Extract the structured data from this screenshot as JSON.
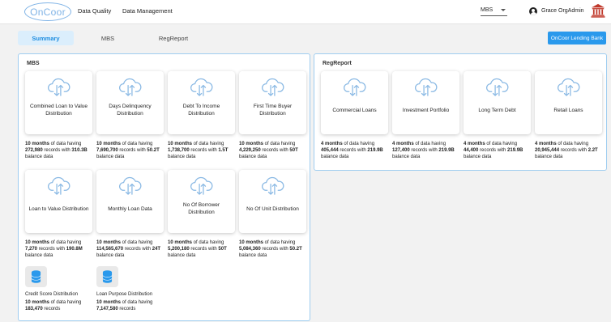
{
  "header": {
    "logo": "OnCoor",
    "nav": [
      "Data Quality",
      "Data Management"
    ],
    "select": "MBS",
    "user": "Grace OrgAdmin"
  },
  "tabs": [
    "Summary",
    "MBS",
    "RegReport"
  ],
  "bank_button": "OnCoor Lending Bank",
  "colors": {
    "accent": "#2a99ec",
    "tab_active_bg": "#dbeefc",
    "panel_border": "#9fcdf0",
    "icon": "#8ab9e4",
    "bank_icon": "#c0392b"
  },
  "mbs": {
    "title": "MBS",
    "tiles": [
      {
        "label": "Combined Loan to Value Distribution",
        "months": "10 months",
        "d1": " of data having ",
        "records": "272,980",
        "d2": " records with ",
        "balance": "310.3B",
        "d3": " balance data"
      },
      {
        "label": "Days Delinquency Distribution",
        "months": "10 months",
        "d1": " of data having ",
        "records": "7,690,700",
        "d2": " records with ",
        "balance": "50.2T",
        "d3": " balance data"
      },
      {
        "label": "Debt To Income Distribution",
        "months": "10 months",
        "d1": " of data having ",
        "records": "1,738,700",
        "d2": " records with ",
        "balance": "1.5T",
        "d3": " balance data"
      },
      {
        "label": "First Time Buyer Distribution",
        "months": "10 months",
        "d1": " of data having ",
        "records": "4,229,250",
        "d2": " records with ",
        "balance": "50T",
        "d3": " balance data"
      },
      {
        "label": "Loan to Value Distribution",
        "months": "10 months",
        "d1": " of data having ",
        "records": "7,270",
        "d2": " records with ",
        "balance": "190.8M",
        "d3": " balance data"
      },
      {
        "label": "Monthly Loan Data",
        "months": "10 months",
        "d1": " of data having ",
        "records": "114,565,670",
        "d2": " records with ",
        "balance": "24T",
        "d3": " balance data"
      },
      {
        "label": "No Of Borrower Distribution",
        "months": "10 months",
        "d1": " of data having ",
        "records": "5,200,180",
        "d2": " records with ",
        "balance": "50T",
        "d3": " balance data"
      },
      {
        "label": "No Of Unit Distribution",
        "months": "10 months",
        "d1": " of data having ",
        "records": "5,084,360",
        "d2": " records with ",
        "balance": "50.2T",
        "d3": " balance data"
      }
    ],
    "mini": [
      {
        "label": "Credit Score Distribution",
        "months": "10 months",
        "d1": " of data having ",
        "records": "183,470",
        "d2": " records"
      },
      {
        "label": "Loan Purpose Distribution",
        "months": "10 months",
        "d1": " of data having ",
        "records": "7,147,580",
        "d2": " records"
      }
    ]
  },
  "regreport": {
    "title": "RegReport",
    "tiles": [
      {
        "label": "Commercial Loans",
        "months": "4 months",
        "d1": " of data having ",
        "records": "405,444",
        "d2": " records with ",
        "balance": "219.9B",
        "d3": " balance data"
      },
      {
        "label": "Investment Portfolio",
        "months": "4 months",
        "d1": " of data having ",
        "records": "127,400",
        "d2": " records with ",
        "balance": "219.9B",
        "d3": " balance data"
      },
      {
        "label": "Long Term Debt",
        "months": "4 months",
        "d1": " of data having ",
        "records": "44,400",
        "d2": " records with ",
        "balance": "219.9B",
        "d3": " balance data"
      },
      {
        "label": "Retail Loans",
        "months": "4 months",
        "d1": " of data having ",
        "records": "20,945,444",
        "d2": " records with ",
        "balance": "2.2T",
        "d3": " balance data"
      }
    ]
  }
}
